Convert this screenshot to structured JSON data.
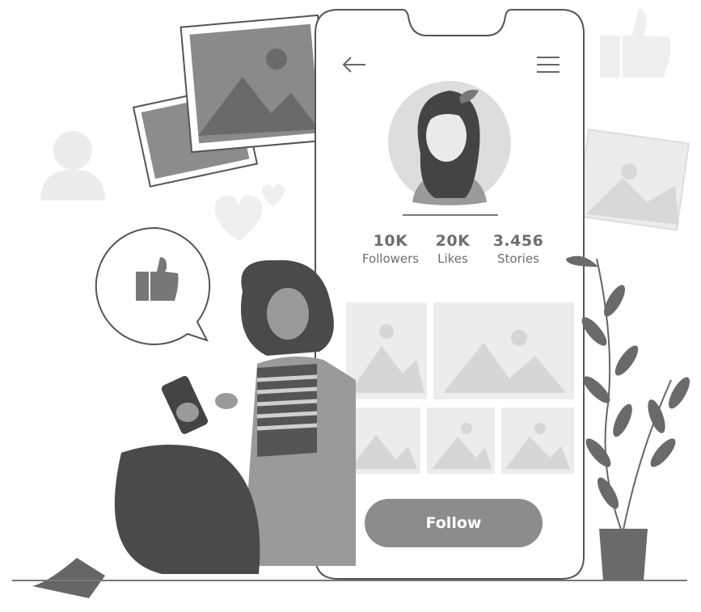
{
  "profile": {
    "stats": [
      {
        "value": "10K",
        "label": "Followers"
      },
      {
        "value": "20K",
        "label": "Likes"
      },
      {
        "value": "3.456",
        "label": "Stories"
      }
    ],
    "follow_label": "Follow"
  },
  "icons": {
    "back": "arrow-left-icon",
    "menu": "hamburger-menu-icon",
    "like": "thumbs-up-icon",
    "heart": "heart-icon",
    "user": "user-icon"
  },
  "colors": {
    "button": "#8c8c8c",
    "text": "#6e6e6e",
    "background": "#ffffff"
  }
}
